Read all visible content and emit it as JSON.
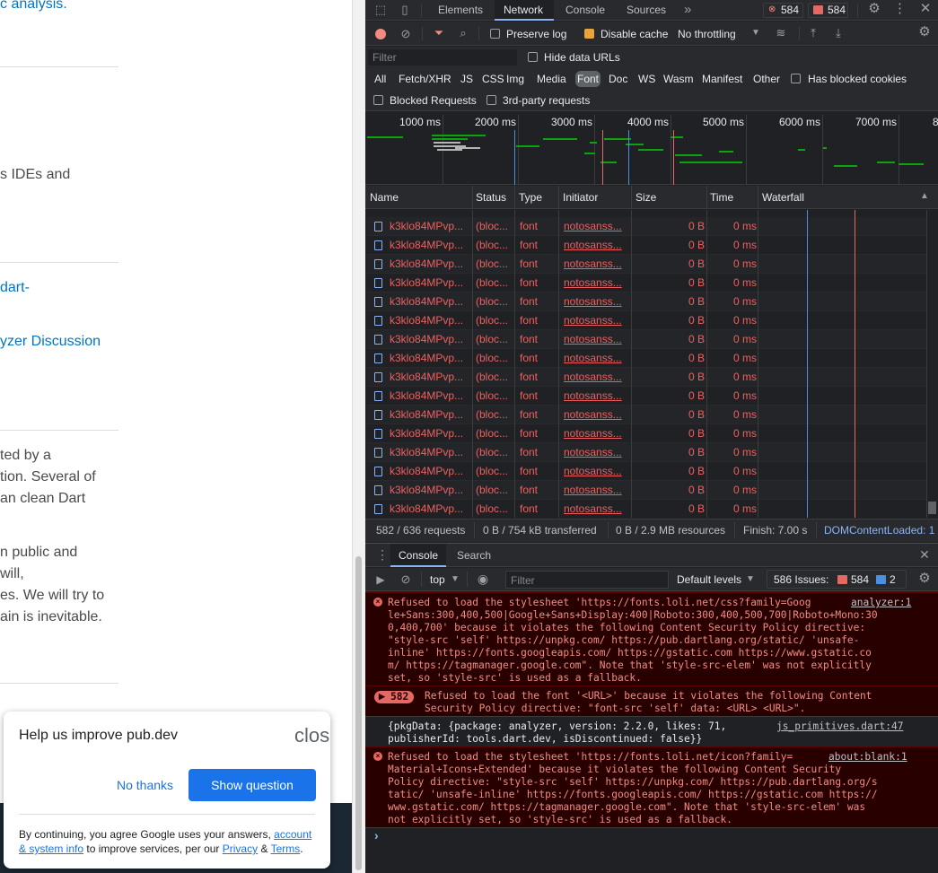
{
  "left_page": {
    "top_link": "c analysis.",
    "text_ides": "s IDEs and",
    "link_dart": "dart-",
    "link_analyzer": "yzer Discussion",
    "para1": [
      "ted by a",
      "tion. Several of",
      "an clean Dart"
    ],
    "para2": [
      "n public and",
      " will,",
      "es. We will try to",
      "ain is inevitable."
    ]
  },
  "survey": {
    "title": "Help us improve pub.dev",
    "close_label": "clos",
    "no_thanks": "No thanks",
    "show_question": "Show question",
    "disclaimer_prefix": "By continuing, you agree Google uses your answers, ",
    "disclaimer_link1": "account & system info",
    "disclaimer_mid": " to improve services, per our ",
    "disclaimer_link2": "Privacy",
    "disclaimer_amp": " & ",
    "disclaimer_link3": "Terms",
    "disclaimer_end": "."
  },
  "devtools": {
    "tabs": [
      "Elements",
      "Network",
      "Console",
      "Sources"
    ],
    "active_tab": "Network",
    "more_tabs": "»",
    "error_count": "584",
    "warning_count": "584",
    "toolbar": {
      "preserve_log": "Preserve log",
      "disable_cache": "Disable cache",
      "throttling": "No throttling"
    },
    "filter_placeholder": "Filter",
    "hide_data_urls": "Hide data URLs",
    "type_filters": [
      "All",
      "Fetch/XHR",
      "JS",
      "CSS",
      "Img",
      "Media",
      "Font",
      "Doc",
      "WS",
      "Wasm",
      "Manifest",
      "Other"
    ],
    "active_type": "Font",
    "has_blocked_cookies": "Has blocked cookies",
    "blocked_requests": "Blocked Requests",
    "third_party": "3rd-party requests",
    "timeline_ticks": [
      "1000 ms",
      "2000 ms",
      "3000 ms",
      "4000 ms",
      "5000 ms",
      "6000 ms",
      "7000 ms",
      "8"
    ],
    "columns": [
      "Name",
      "Status",
      "Type",
      "Initiator",
      "Size",
      "Time",
      "Waterfall"
    ],
    "rows": [
      {
        "name": "k3klo84MPvp...",
        "status": "(bloc...",
        "type": "font",
        "initiator": "notosanss...",
        "size": "0 B",
        "time": "0 ms"
      },
      {
        "name": "k3klo84MPvp...",
        "status": "(bloc...",
        "type": "font",
        "initiator": "notosanss...",
        "size": "0 B",
        "time": "0 ms"
      },
      {
        "name": "k3klo84MPvp...",
        "status": "(bloc...",
        "type": "font",
        "initiator": "notosanss...",
        "size": "0 B",
        "time": "0 ms"
      },
      {
        "name": "k3klo84MPvp...",
        "status": "(bloc...",
        "type": "font",
        "initiator": "notosanss...",
        "size": "0 B",
        "time": "0 ms"
      },
      {
        "name": "k3klo84MPvp...",
        "status": "(bloc...",
        "type": "font",
        "initiator": "notosanss...",
        "size": "0 B",
        "time": "0 ms"
      },
      {
        "name": "k3klo84MPvp...",
        "status": "(bloc...",
        "type": "font",
        "initiator": "notosanss...",
        "size": "0 B",
        "time": "0 ms"
      },
      {
        "name": "k3klo84MPvp...",
        "status": "(bloc...",
        "type": "font",
        "initiator": "notosanss...",
        "size": "0 B",
        "time": "0 ms"
      },
      {
        "name": "k3klo84MPvp...",
        "status": "(bloc...",
        "type": "font",
        "initiator": "notosanss...",
        "size": "0 B",
        "time": "0 ms"
      },
      {
        "name": "k3klo84MPvp...",
        "status": "(bloc...",
        "type": "font",
        "initiator": "notosanss...",
        "size": "0 B",
        "time": "0 ms"
      },
      {
        "name": "k3klo84MPvp...",
        "status": "(bloc...",
        "type": "font",
        "initiator": "notosanss...",
        "size": "0 B",
        "time": "0 ms"
      },
      {
        "name": "k3klo84MPvp...",
        "status": "(bloc...",
        "type": "font",
        "initiator": "notosanss...",
        "size": "0 B",
        "time": "0 ms"
      },
      {
        "name": "k3klo84MPvp...",
        "status": "(bloc...",
        "type": "font",
        "initiator": "notosanss...",
        "size": "0 B",
        "time": "0 ms"
      },
      {
        "name": "k3klo84MPvp...",
        "status": "(bloc...",
        "type": "font",
        "initiator": "notosanss...",
        "size": "0 B",
        "time": "0 ms"
      },
      {
        "name": "k3klo84MPvp...",
        "status": "(bloc...",
        "type": "font",
        "initiator": "notosanss...",
        "size": "0 B",
        "time": "0 ms"
      },
      {
        "name": "k3klo84MPvp...",
        "status": "(bloc...",
        "type": "font",
        "initiator": "notosanss...",
        "size": "0 B",
        "time": "0 ms"
      },
      {
        "name": "k3klo84MPvp...",
        "status": "(bloc...",
        "type": "font",
        "initiator": "notosanss...",
        "size": "0 B",
        "time": "0 ms"
      }
    ],
    "status_bar": {
      "requests": "582 / 636 requests",
      "transferred": "0 B / 754 kB transferred",
      "resources": "0 B / 2.9 MB resources",
      "finish": "Finish: 7.00 s",
      "dom_loaded": "DOMContentLoaded: 1"
    },
    "drawer_tabs": [
      "Console",
      "Search"
    ],
    "console_toolbar": {
      "context": "top",
      "filter_placeholder": "Filter",
      "levels": "Default levels",
      "issues_label": "586 Issues:",
      "issues_errors": "584",
      "issues_info": "2"
    },
    "messages": [
      {
        "lines": [
          "Refused to load the stylesheet 'https://fonts.loli.net/css?family=Goog",
          "le+Sans:300,400,500|Google+Sans+Display:400|Roboto:300,400,500,700|Roboto+Mono:30",
          "0,400,700' because it violates the following Content Security Policy directive:",
          "\"style-src 'self' https://unpkg.com/ https://pub.dartlang.org/static/ 'unsafe-",
          "inline' https://fonts.googleapis.com/ https://gstatic.com https://www.gstatic.co",
          "m/ https://tagmanager.google.com\". Note that 'style-src-elem' was not explicitly",
          "set, so 'style-src' is used as a fallback."
        ],
        "source": "analyzer:1"
      },
      {
        "count": "582",
        "lines": [
          "Refused to load the font '<URL>' because it violates the following Content",
          "Security Policy directive: \"font-src 'self' data: <URL> <URL>\"."
        ]
      },
      {
        "lines": [
          "{pkgData: {package: analyzer, version: 2.2.0, likes: 71,",
          "publisherId: tools.dart.dev, isDiscontinued: false}}"
        ],
        "source": "js_primitives.dart:47"
      },
      {
        "lines": [
          "Refused to load the stylesheet 'https://fonts.loli.net/icon?family=",
          "Material+Icons+Extended' because it violates the following Content Security",
          "Policy directive: \"style-src 'self' https://unpkg.com/ https://pub.dartlang.org/s",
          "tatic/ 'unsafe-inline' https://fonts.googleapis.com/ https://gstatic.com https://",
          "www.gstatic.com/ https://tagmanager.google.com\". Note that 'style-src-elem' was",
          "not explicitly set, so 'style-src' is used as a fallback."
        ],
        "source": "about:blank:1"
      }
    ],
    "prompt": "›"
  }
}
